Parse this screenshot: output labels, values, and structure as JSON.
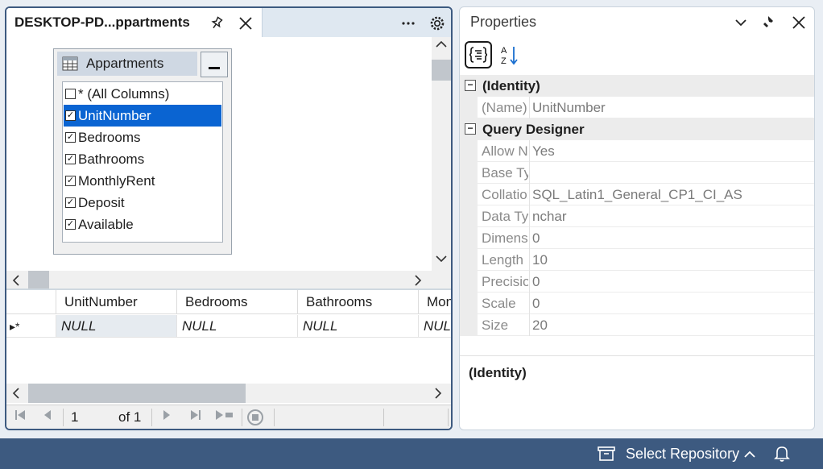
{
  "document_window": {
    "tab_title": "DESKTOP-PD...ppartments",
    "table": {
      "name": "Appartments",
      "columns": [
        {
          "label": "* (All Columns)",
          "checked": false,
          "selected": false
        },
        {
          "label": "UnitNumber",
          "checked": true,
          "selected": true
        },
        {
          "label": "Bedrooms",
          "checked": true,
          "selected": false
        },
        {
          "label": "Bathrooms",
          "checked": true,
          "selected": false
        },
        {
          "label": "MonthlyRent",
          "checked": true,
          "selected": false
        },
        {
          "label": "Deposit",
          "checked": true,
          "selected": false
        },
        {
          "label": "Available",
          "checked": true,
          "selected": false
        }
      ]
    },
    "grid": {
      "row_marker": "▸*",
      "headers": [
        "UnitNumber",
        "Bedrooms",
        "Bathrooms",
        "Mon"
      ],
      "row": [
        "NULL",
        "NULL",
        "NULL",
        "NUL"
      ]
    },
    "navigator": {
      "current": "1",
      "of_label": "of 1"
    }
  },
  "properties": {
    "title": "Properties",
    "categories": [
      {
        "label": "(Identity)",
        "rows": [
          {
            "name": "(Name)",
            "value": "UnitNumber"
          }
        ]
      },
      {
        "label": "Query Designer",
        "rows": [
          {
            "name": "Allow Nulls",
            "value": "Yes"
          },
          {
            "name": "Base Type",
            "value": ""
          },
          {
            "name": "Collation",
            "value": "SQL_Latin1_General_CP1_CI_AS"
          },
          {
            "name": "Data Type",
            "value": "nchar"
          },
          {
            "name": "Dimensions",
            "value": "0"
          },
          {
            "name": "Length",
            "value": "10"
          },
          {
            "name": "Precision",
            "value": "0"
          },
          {
            "name": "Scale",
            "value": "0"
          },
          {
            "name": "Size",
            "value": "20"
          }
        ]
      }
    ],
    "description_title": "(Identity)"
  },
  "statusbar": {
    "repo_label": "Select Repository"
  },
  "colors": {
    "accent": "#3d5a80",
    "selection": "#0a64d2"
  },
  "icons": [
    "pin-icon",
    "close-icon",
    "more-icon",
    "settings-icon",
    "table-icon",
    "minimize-icon",
    "categorized-icon",
    "alphabetical-sort-icon",
    "chevron-down-icon",
    "repository-icon",
    "chevron-up-icon",
    "bell-icon"
  ]
}
